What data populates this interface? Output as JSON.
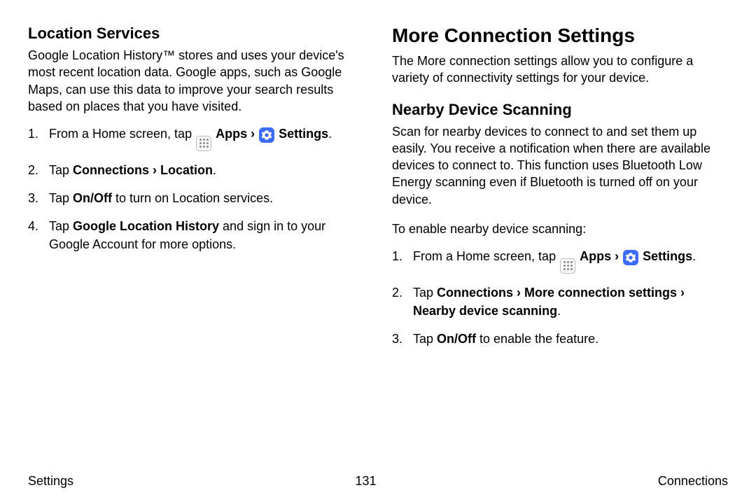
{
  "left": {
    "heading": "Location Services",
    "intro": "Google Location History™ stores and uses your device's most recent location data. Google apps, such as Google Maps, can use this data to improve your search results based on places that you have visited.",
    "step1_pre": "From a Home screen, tap ",
    "apps_label": "Apps",
    "step1_sep": " › ",
    "settings_label": "Settings",
    "step1_end": ".",
    "step2_pre": "Tap ",
    "step2_bold": "Connections › Location",
    "step2_end": ".",
    "step3_pre": "Tap ",
    "step3_bold": "On/Off",
    "step3_end": " to turn on Location services.",
    "step4_pre": "Tap ",
    "step4_bold": "Google Location History",
    "step4_end": " and sign in to your Google Account for more options."
  },
  "right": {
    "heading": "More Connection Settings",
    "intro": "The More connection settings allow you to configure a variety of connectivity settings for your device.",
    "sub_heading": "Nearby Device Scanning",
    "sub_intro": "Scan for nearby devices to connect to and set them up easily. You receive a notification when there are available devices to connect to. This function uses Bluetooth Low Energy scanning even if Bluetooth is turned off on your device.",
    "enable_intro": "To enable nearby device scanning:",
    "step1_pre": "From a Home screen, tap ",
    "apps_label": "Apps",
    "step1_sep": " › ",
    "settings_label": "Settings",
    "step1_end": ".",
    "step2_pre": "Tap ",
    "step2_bold": "Connections › More connection settings › Nearby device scanning",
    "step2_end": ".",
    "step3_pre": "Tap ",
    "step3_bold": "On/Off",
    "step3_end": " to enable the feature."
  },
  "footer": {
    "left": "Settings",
    "center": "131",
    "right": "Connections"
  }
}
